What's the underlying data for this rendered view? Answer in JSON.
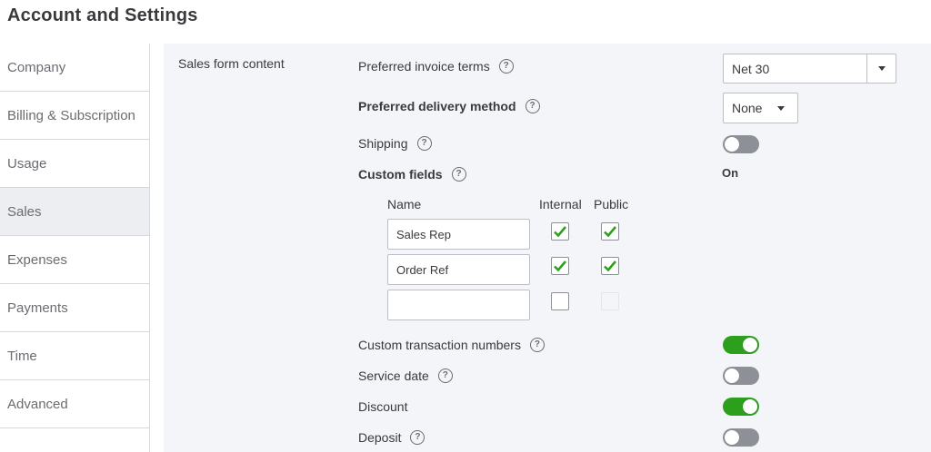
{
  "page": {
    "title": "Account and Settings"
  },
  "sidebar": {
    "items": [
      {
        "label": "Company",
        "active": false
      },
      {
        "label": "Billing & Subscription",
        "active": false
      },
      {
        "label": "Usage",
        "active": false
      },
      {
        "label": "Sales",
        "active": true
      },
      {
        "label": "Expenses",
        "active": false
      },
      {
        "label": "Payments",
        "active": false
      },
      {
        "label": "Time",
        "active": false
      },
      {
        "label": "Advanced",
        "active": false
      }
    ]
  },
  "section": {
    "title": "Sales form content",
    "invoice_terms": {
      "label": "Preferred invoice terms",
      "value": "Net 30"
    },
    "delivery_method": {
      "label": "Preferred delivery method",
      "value": "None"
    },
    "shipping": {
      "label": "Shipping",
      "on": false
    },
    "custom_fields": {
      "label": "Custom fields",
      "status": "On",
      "columns": {
        "name": "Name",
        "internal": "Internal",
        "public": "Public"
      },
      "rows": [
        {
          "name": "Sales Rep",
          "internal": true,
          "public": true
        },
        {
          "name": "Order Ref",
          "internal": true,
          "public": true
        },
        {
          "name": "",
          "internal": false,
          "public": false
        }
      ]
    },
    "custom_txn_numbers": {
      "label": "Custom transaction numbers",
      "on": true
    },
    "service_date": {
      "label": "Service date",
      "on": false
    },
    "discount": {
      "label": "Discount",
      "on": true
    },
    "deposit": {
      "label": "Deposit",
      "on": false
    }
  },
  "icons": {
    "help": "question-circle-icon",
    "check": "checkmark-icon",
    "dropdown": "caret-down-icon"
  },
  "colors": {
    "toggle_on": "#2ca01c",
    "toggle_off": "#8d9096",
    "panel_bg": "#f4f5f8"
  }
}
